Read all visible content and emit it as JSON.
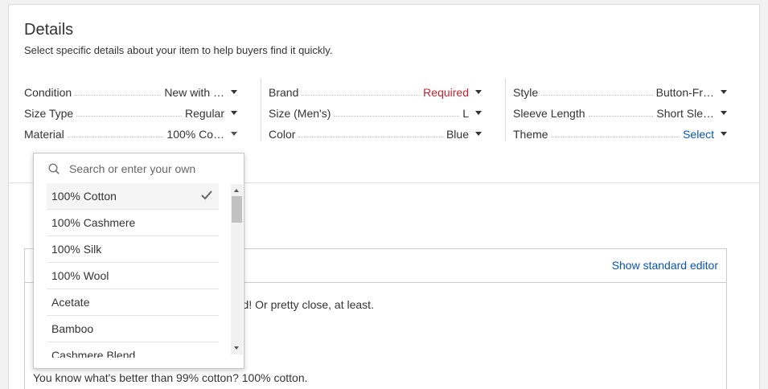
{
  "details": {
    "title": "Details",
    "subtitle": "Select specific details about your item to help buyers find it quickly."
  },
  "columns": [
    [
      {
        "label": "Condition",
        "value": "New with …",
        "style": "normal"
      },
      {
        "label": "Size Type",
        "value": "Regular",
        "style": "normal"
      },
      {
        "label": "Material",
        "value": "100% Co…",
        "style": "normal"
      }
    ],
    [
      {
        "label": "Brand",
        "value": "Required",
        "style": "required"
      },
      {
        "label": "Size (Men's)",
        "value": "L",
        "style": "normal"
      },
      {
        "label": "Color",
        "value": "Blue",
        "style": "normal"
      }
    ],
    [
      {
        "label": "Style",
        "value": "Button-Fr…",
        "style": "normal"
      },
      {
        "label": "Sleeve Length",
        "value": "Short Sle…",
        "style": "normal"
      },
      {
        "label": "Theme",
        "value": "Select",
        "style": "link"
      }
    ]
  ],
  "dropdown": {
    "search_placeholder": "Search or enter your own",
    "options": [
      "100% Cotton",
      "100% Cashmere",
      "100% Silk",
      "100% Wool",
      "Acetate",
      "Bamboo",
      "Cashmere Blend"
    ],
    "selected": "100% Cotton"
  },
  "editor": {
    "toggle_label": "Show standard editor",
    "line1_visible": "orld! Or pretty close, at least.",
    "line2": "You know what's better than 99% cotton? 100% cotton."
  },
  "colors": {
    "required": "#c8232c",
    "link": "#0654ba",
    "border": "#dddddd"
  }
}
